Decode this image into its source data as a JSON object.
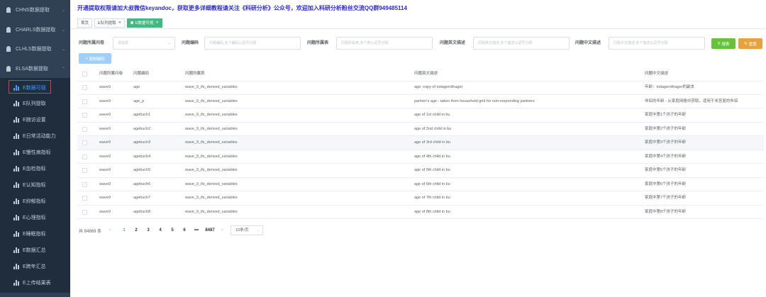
{
  "sidebar": {
    "groups": [
      {
        "label": "CHNS数据提取"
      },
      {
        "label": "CHARLS数据提取"
      },
      {
        "label": "CLHLS数据提取"
      },
      {
        "label": "ELSA数据提取"
      }
    ],
    "sub_items": [
      {
        "label": "E数据可视",
        "active": true
      },
      {
        "label": "E队列提取"
      },
      {
        "label": "E随访设置"
      },
      {
        "label": "E日常活动能力"
      },
      {
        "label": "E慢性病指标"
      },
      {
        "label": "E血检指标"
      },
      {
        "label": "E认知指标"
      },
      {
        "label": "E抑郁指标"
      },
      {
        "label": "E心理指标"
      },
      {
        "label": "E睡眠指标"
      },
      {
        "label": "E数据汇总"
      },
      {
        "label": "E跨年汇总"
      },
      {
        "label": "E上传结果表"
      }
    ]
  },
  "notice": "开通提取权限请加大叔微信keyandoc，获取更多详细教程请关注《科研分析》公众号，欢迎加入科研分析粉丝交流QQ群949485114",
  "tags": [
    {
      "label": "首页"
    },
    {
      "label": "E队列提取",
      "closable": true
    },
    {
      "label": "E数据可视",
      "closable": true,
      "active": true
    }
  ],
  "filters": {
    "wave_label": "问题所属问卷",
    "wave_placeholder": "请选择",
    "code_label": "问题编码",
    "code_placeholder": "问题编码,多个编码以逗号分隔",
    "group_label": "问题所属表",
    "group_placeholder": "问题所属表,多个表以逗号分隔",
    "en_label": "问题英文描述",
    "en_placeholder": "问题英文描述,多个描述以逗号分隔",
    "cn_label": "问题中文描述",
    "cn_placeholder": "问题中文描述,多个描述以逗号分隔",
    "search_label": "搜索",
    "reset_label": "重置",
    "copy_label": "复制编码"
  },
  "table": {
    "headers": [
      "问题所属问卷",
      "问题编码",
      "问题所属表",
      "问题英文描述",
      "问题中文描述"
    ],
    "rows": [
      [
        "wave9",
        "age",
        "wave_9_ifs_derived_variables",
        "age: copy of indager/dhager",
        "年龄：indager/dhager的副本"
      ],
      [
        "wave9",
        "age_p",
        "wave_9_ifs_derived_variables",
        "partner's age - taken from household grid for non-responding partners",
        "伴侣的年龄 - 从家庭网格中获取，适用于未答复的伴侣"
      ],
      [
        "wave9",
        "agebuch1",
        "wave_9_ifs_derived_variables",
        "age of 1st child in bu",
        "家庭中第1个孩子的年龄"
      ],
      [
        "wave9",
        "agebuch2",
        "wave_9_ifs_derived_variables",
        "age of 2nd child in bu",
        "家庭中第2个孩子的年龄"
      ],
      [
        "wave9",
        "agebuch3",
        "wave_9_ifs_derived_variables",
        "age of 3rd child in bu",
        "家庭中第3个孩子的年龄"
      ],
      [
        "wave9",
        "agebuch4",
        "wave_9_ifs_derived_variables",
        "age of 4th child in bu",
        "家庭中第4个孩子的年龄"
      ],
      [
        "wave9",
        "agebuch5",
        "wave_9_ifs_derived_variables",
        "age of 5th child in bu",
        "家庭中第5个孩子的年龄"
      ],
      [
        "wave9",
        "agebuch6",
        "wave_9_ifs_derived_variables",
        "age of 6th child in bu",
        "家庭中第6个孩子的年龄"
      ],
      [
        "wave9",
        "agebuch7",
        "wave_9_ifs_derived_variables",
        "age of 7th child in bu",
        "家庭中第7个孩子的年龄"
      ],
      [
        "wave9",
        "agebuch8",
        "wave_9_ifs_derived_variables",
        "age of 8th child in bu",
        "家庭中第8个孩子的年龄"
      ]
    ]
  },
  "pagination": {
    "total": "共 84869 条",
    "prev": "<",
    "next": ">",
    "pages": [
      "1",
      "2",
      "3",
      "4",
      "5",
      "6",
      "•••",
      "8487"
    ],
    "current": "1",
    "page_size": "10条/页"
  }
}
